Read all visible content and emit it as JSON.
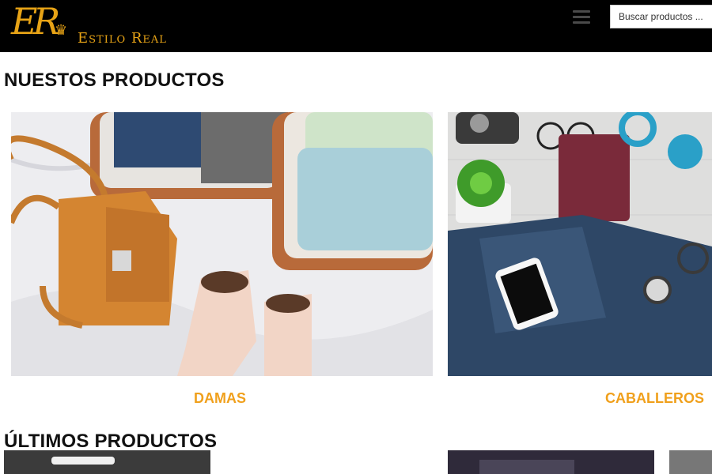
{
  "header": {
    "logo_monogram": "ER",
    "logo_name": "Estilo Real",
    "search_placeholder": "Buscar productos ...",
    "menu_icon": "hamburger-menu-icon"
  },
  "sections": {
    "our_products_title": "NUESTOS PRODUCTOS",
    "latest_products_title": "ÚLTIMOS PRODUCTOS"
  },
  "categories": [
    {
      "label": "DAMAS"
    },
    {
      "label": "CABALLEROS"
    }
  ],
  "colors": {
    "header_bg": "#000000",
    "brand_gold": "#e7a316",
    "category_label": "#f0a01c"
  }
}
